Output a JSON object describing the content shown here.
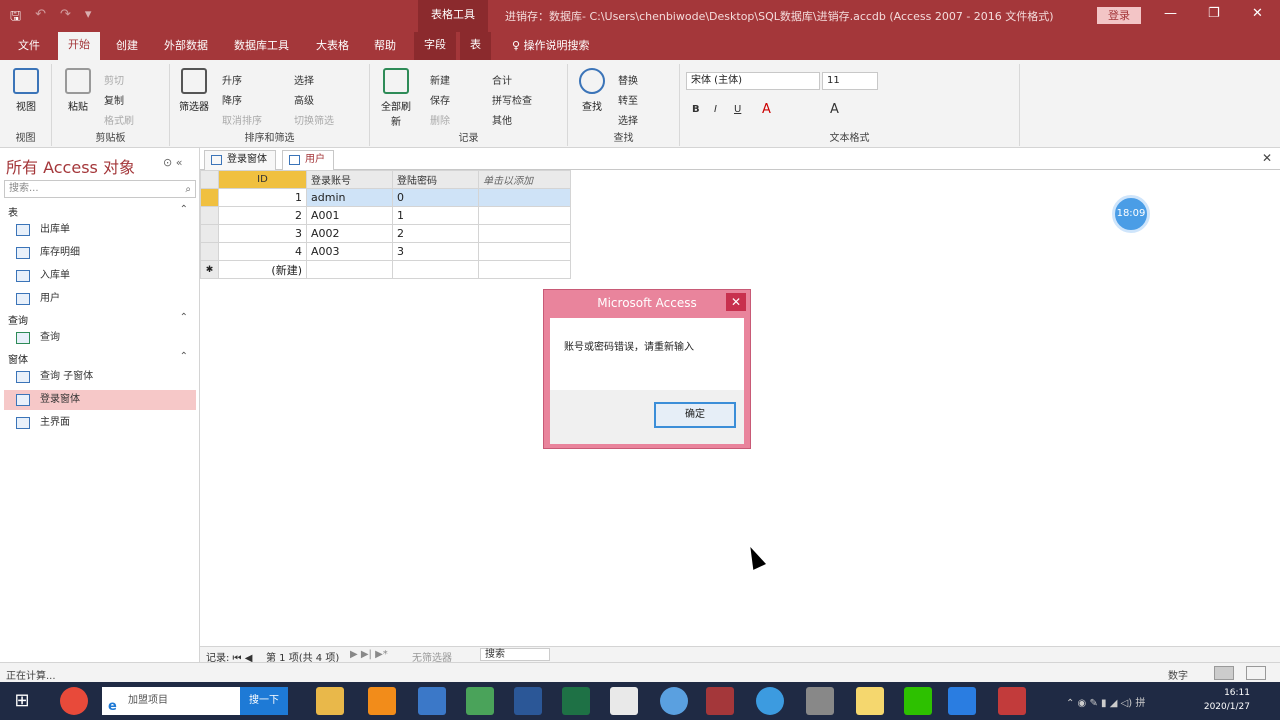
{
  "titlebar": {
    "context_tab": "表格工具",
    "title": "进销存：数据库- C:\\Users\\chenbiwode\\Desktop\\SQL数据库\\进销存.accdb (Access 2007 - 2016 文件格式)",
    "login": "登录",
    "minimize": "—",
    "restore": "❐",
    "close": "✕"
  },
  "tabs": [
    "文件",
    "开始",
    "创建",
    "外部数据",
    "数据库工具",
    "大表格",
    "帮助",
    "字段",
    "表",
    "操作说明搜索"
  ],
  "ribbon": {
    "views": {
      "view": "视图",
      "group": "视图"
    },
    "clipboard": {
      "paste": "粘贴",
      "cut": "剪切",
      "copy": "复制",
      "format_painter": "格式刷",
      "group": "剪贴板"
    },
    "sort_filter": {
      "filter": "筛选器",
      "ascending": "升序",
      "descending": "降序",
      "remove_sort": "取消排序",
      "selection": "选择",
      "advanced": "高级",
      "toggle_filter": "切换筛选",
      "group": "排序和筛选"
    },
    "records": {
      "refresh_all": "全部刷新",
      "new": "新建",
      "save": "保存",
      "delete": "删除",
      "totals": "合计",
      "spelling": "拼写检查",
      "more": "其他",
      "group": "记录"
    },
    "find": {
      "find": "查找",
      "replace": "替换",
      "goto": "转至",
      "select": "选择",
      "group": "查找"
    },
    "text_format": {
      "font": "宋体 (主体)",
      "size": "11",
      "bold": "B",
      "italic": "I",
      "underline": "U",
      "group": "文本格式"
    }
  },
  "navpane": {
    "header": "所有 Access 对象",
    "header_btn": "⊙ «",
    "search_placeholder": "搜索...",
    "sections": [
      {
        "name": "表",
        "items": [
          "出库单",
          "库存明细",
          "入库单",
          "用户"
        ]
      },
      {
        "name": "查询",
        "items": [
          "查询"
        ]
      },
      {
        "name": "窗体",
        "items": [
          "查询 子窗体",
          "登录窗体",
          "主界面"
        ]
      }
    ],
    "selected": "登录窗体"
  },
  "doctabs": [
    "登录窗体",
    "用户"
  ],
  "table": {
    "headers": [
      "ID",
      "登录账号",
      "登陆密码",
      "单击以添加"
    ],
    "rows": [
      [
        "1",
        "admin",
        "0"
      ],
      [
        "2",
        "A001",
        "1"
      ],
      [
        "3",
        "A002",
        "2"
      ],
      [
        "4",
        "A003",
        "3"
      ]
    ],
    "new_row": "(新建)"
  },
  "bubble": "18:09",
  "dialog": {
    "title": "Microsoft Access",
    "message": "账号或密码错误，请重新输入",
    "ok": "确定"
  },
  "recnav": {
    "label": "记录: ⏮ ◀",
    "position": "第 1 项(共 4 项)",
    "next": "▶ ▶| ▶*",
    "filter": "无筛选器",
    "search": "搜索"
  },
  "status": {
    "left": "正在计算...",
    "right": "数字"
  },
  "taskbar": {
    "search_text": "加盟项目",
    "search_btn": "搜一下",
    "time": "16:11",
    "date": "2020/1/27"
  }
}
